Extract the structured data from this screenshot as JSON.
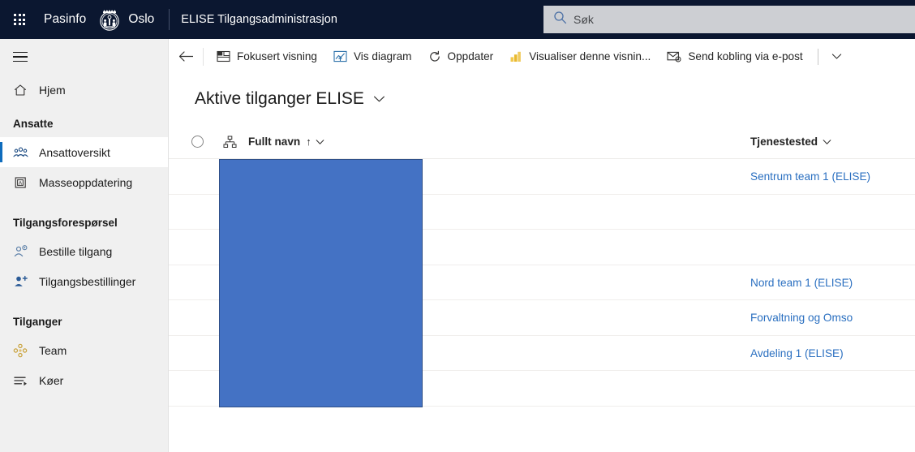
{
  "header": {
    "waffle_icon": "app-launcher-waffle-icon",
    "pasinfo_label": "Pasinfo",
    "oslo_crest_icon": "oslo-coat-of-arms-icon",
    "oslo_label": "Oslo",
    "app_title": "ELISE Tilgangsadministrasjon",
    "bg_color": "#0b1730"
  },
  "search": {
    "icon": "search-icon",
    "placeholder": "Søk",
    "value": "",
    "bg_color": "#cdcfd3"
  },
  "sidebar": {
    "hamburger_icon": "hamburger-menu-icon",
    "bg_color": "#f0f0f0",
    "accent_color": "#0f6cbd",
    "home": {
      "label": "Hjem",
      "icon": "home-icon"
    },
    "groups": [
      {
        "title": "Ansatte",
        "items": [
          {
            "label": "Ansattoversikt",
            "icon": "people-group-icon",
            "selected": true
          },
          {
            "label": "Masseoppdatering",
            "icon": "bulk-update-icon",
            "selected": false
          }
        ]
      },
      {
        "title": "Tilgangsforespørsel",
        "items": [
          {
            "label": "Bestille tilgang",
            "icon": "person-settings-icon",
            "selected": false
          },
          {
            "label": "Tilgangsbestillinger",
            "icon": "person-add-icon",
            "selected": false
          }
        ]
      },
      {
        "title": "Tilganger",
        "items": [
          {
            "label": "Team",
            "icon": "team-icon",
            "selected": false
          },
          {
            "label": "Køer",
            "icon": "queue-icon",
            "selected": false
          }
        ]
      }
    ]
  },
  "commandbar": {
    "back_icon": "back-arrow-icon",
    "buttons": [
      {
        "label": "Fokusert visning",
        "icon": "focused-view-icon"
      },
      {
        "label": "Vis diagram",
        "icon": "show-chart-icon"
      },
      {
        "label": "Oppdater",
        "icon": "refresh-icon"
      },
      {
        "label": "Visualiser denne visnin...",
        "icon": "bar-chart-icon"
      },
      {
        "label": "Send kobling via e-post",
        "icon": "email-link-icon"
      }
    ],
    "overflow_icon": "chevron-down-icon"
  },
  "view": {
    "title": "Aktive tilganger ELISE",
    "title_chevron_icon": "chevron-down-icon"
  },
  "grid": {
    "select_all_icon": "select-all-circle-icon",
    "hierarchy_icon": "hierarchy-icon",
    "columns": [
      {
        "label": "Fullt navn",
        "sort": "↑",
        "chevron_icon": "chevron-down-icon"
      },
      {
        "label": "Tjenestested",
        "chevron_icon": "chevron-down-icon"
      }
    ],
    "rows": [
      {
        "fullt_navn": "",
        "tjenestested": "Sentrum team 1 (ELISE)"
      },
      {
        "fullt_navn": "",
        "tjenestested": ""
      },
      {
        "fullt_navn": "",
        "tjenestested": ""
      },
      {
        "fullt_navn": "",
        "tjenestested": "Nord team 1 (ELISE)"
      },
      {
        "fullt_navn": "",
        "tjenestested": "Forvaltning og Omso"
      },
      {
        "fullt_navn": "",
        "tjenestested": "Avdeling 1 (ELISE)"
      },
      {
        "fullt_navn": "",
        "tjenestested": ""
      }
    ],
    "link_color": "#2a6fc0"
  },
  "overlay": {
    "shape": "blue-rectangle",
    "fill_color": "#4472c4",
    "border_color": "#2f4f87"
  }
}
